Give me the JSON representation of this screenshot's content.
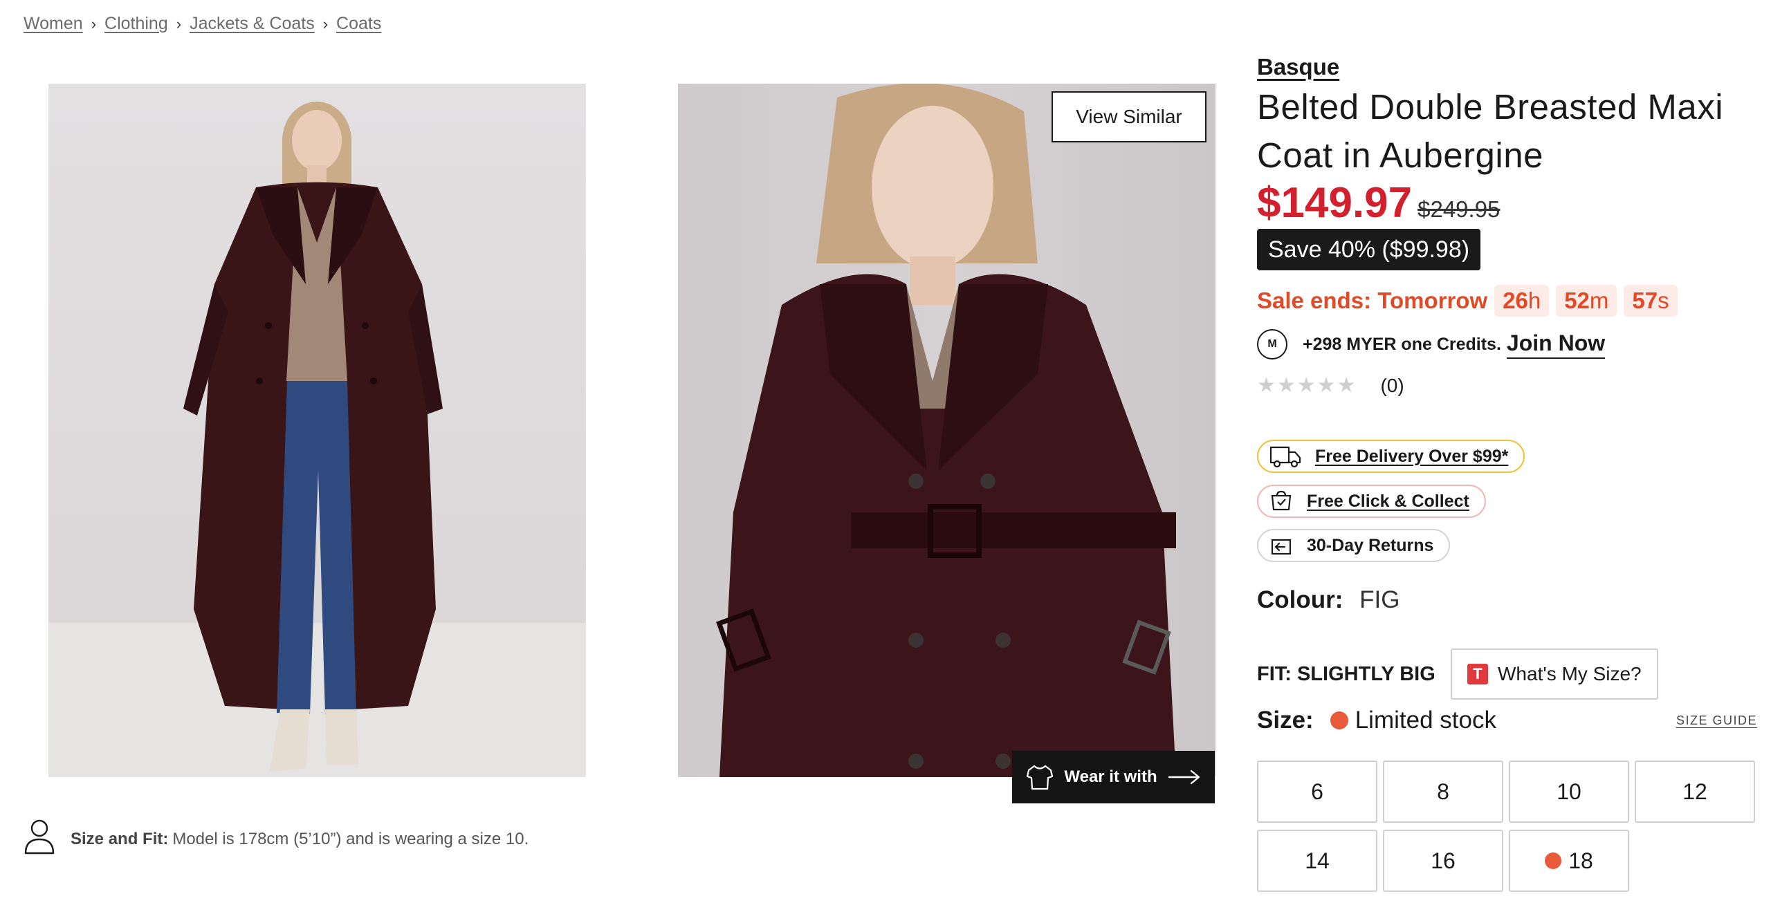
{
  "breadcrumb": [
    {
      "label": "Women"
    },
    {
      "label": "Clothing"
    },
    {
      "label": "Jackets & Coats"
    },
    {
      "label": "Coats"
    }
  ],
  "gallery": {
    "view_similar": "View Similar",
    "wear_it_with": "Wear it with"
  },
  "size_fit_note": {
    "label": "Size and Fit:",
    "text": "Model is 178cm (5’10”) and is wearing a size 10."
  },
  "product": {
    "brand": "Basque",
    "title": "Belted Double Breasted Maxi Coat in Aubergine",
    "price": "$149.97",
    "was_price": "$249.95",
    "save_badge": "Save 40% ($99.98)",
    "sale": {
      "label": "Sale ends: Tomorrow",
      "hours": "26",
      "hours_unit": "h",
      "minutes": "52",
      "minutes_unit": "m",
      "seconds": "57",
      "seconds_unit": "s"
    },
    "credits": {
      "logo_text": "M",
      "text": "+298 MYER one Credits.",
      "join": "Join Now"
    },
    "rating": {
      "stars_filled": 0,
      "stars_total": 5,
      "count": "(0)"
    },
    "benefits": [
      {
        "label": "Free Delivery Over $99*",
        "icon": "truck-icon"
      },
      {
        "label": "Free Click & Collect",
        "icon": "click-collect-icon"
      },
      {
        "label": "30-Day Returns",
        "icon": "returns-icon"
      }
    ],
    "colour": {
      "label": "Colour:",
      "value": "FIG"
    },
    "fit": {
      "label": "FIT: SLIGHTLY BIG",
      "button": "What's My Size?",
      "logo": "T"
    },
    "size": {
      "label": "Size:",
      "stock": "Limited stock",
      "guide": "SIZE GUIDE",
      "options": [
        {
          "label": "6",
          "limited": false
        },
        {
          "label": "8",
          "limited": false
        },
        {
          "label": "10",
          "limited": false
        },
        {
          "label": "12",
          "limited": false
        },
        {
          "label": "14",
          "limited": false
        },
        {
          "label": "16",
          "limited": false
        },
        {
          "label": "18",
          "limited": true
        }
      ]
    }
  },
  "colors": {
    "sale_red": "#d3202f",
    "sale_orange": "#e04a26",
    "stock_dot": "#e85a3a",
    "coat": "#3a1518"
  }
}
